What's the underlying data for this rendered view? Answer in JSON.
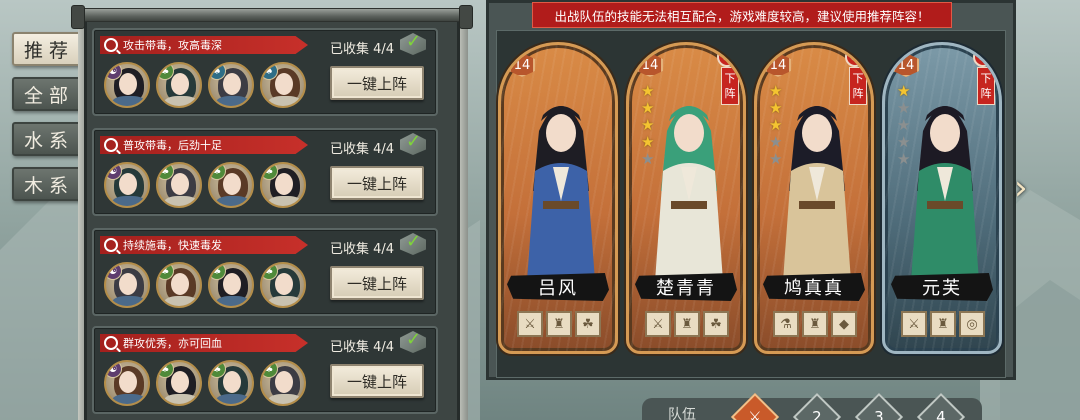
{
  "tabs": [
    {
      "label": "推荐",
      "active": true
    },
    {
      "label": "全部",
      "active": false
    },
    {
      "label": "水系",
      "active": false
    },
    {
      "label": "木系",
      "active": false
    }
  ],
  "teams": [
    {
      "desc": "攻击带毒，攻高毒深",
      "collected": "已收集 4/4",
      "button": "一键上阵",
      "members": [
        {
          "elem": "yin",
          "icon": "☯"
        },
        {
          "elem": "wood",
          "icon": "♣"
        },
        {
          "elem": "water",
          "icon": "♠"
        },
        {
          "elem": "water",
          "icon": "♠"
        }
      ]
    },
    {
      "desc": "普攻带毒，后劲十足",
      "collected": "已收集 4/4",
      "button": "一键上阵",
      "members": [
        {
          "elem": "yin",
          "icon": "☯"
        },
        {
          "elem": "wood",
          "icon": "♣"
        },
        {
          "elem": "wood",
          "icon": "♣"
        },
        {
          "elem": "wood",
          "icon": "♣"
        }
      ]
    },
    {
      "desc": "持续施毒，快速毒发",
      "collected": "已收集 4/4",
      "button": "一键上阵",
      "members": [
        {
          "elem": "yin",
          "icon": "☯"
        },
        {
          "elem": "wood",
          "icon": "♣"
        },
        {
          "elem": "wood",
          "icon": "♣"
        },
        {
          "elem": "wood",
          "icon": "♣"
        }
      ]
    },
    {
      "desc": "群攻优秀，亦可回血",
      "collected": "已收集 4/4",
      "button": "一键上阵",
      "members": [
        {
          "elem": "yin",
          "icon": "☯"
        },
        {
          "elem": "wood",
          "icon": "♣"
        },
        {
          "elem": "wood",
          "icon": "♣"
        },
        {
          "elem": "wood",
          "icon": "♣"
        }
      ]
    }
  ],
  "warning": "出战队伍的技能无法相互配合，游戏难度较高，建议使用推荐阵容！",
  "cards": [
    {
      "name": "吕风",
      "level": "14",
      "stars": 0,
      "removable": false,
      "style": "gold",
      "robe": "#3d62a8",
      "hair": "#1e1d24",
      "equip": [
        "⚔",
        "♜",
        "☘"
      ]
    },
    {
      "name": "楚青青",
      "level": "14",
      "stars": 4,
      "removable": true,
      "remove_label": "下阵",
      "style": "gold",
      "robe": "#e8e6d8",
      "hair": "#3aa07a",
      "equip": [
        "⚔",
        "♜",
        "☘"
      ]
    },
    {
      "name": "鸠真真",
      "level": "14",
      "stars": 3,
      "removable": true,
      "remove_label": "下阵",
      "style": "gold",
      "robe": "#d9c49a",
      "hair": "#1c1c28",
      "equip": [
        "⚗",
        "♜",
        "◆"
      ]
    },
    {
      "name": "元芙",
      "level": "14",
      "stars": 1,
      "removable": true,
      "remove_label": "下阵",
      "style": "blue",
      "robe": "#2f8c68",
      "hair": "#1d1a24",
      "equip": [
        "⚔",
        "♜",
        "◎"
      ]
    }
  ],
  "team_selector": {
    "label": "队伍",
    "slots": [
      "",
      "2",
      "3",
      "4"
    ],
    "active": 0
  },
  "icons": {
    "next": "chevron-right-icon",
    "check": "check-icon",
    "search": "magnifier-icon"
  }
}
